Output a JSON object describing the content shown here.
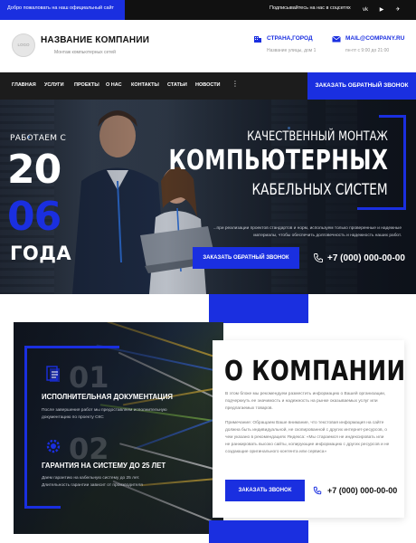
{
  "topbar": {
    "welcome": "Добро пожаловать на наш официальный сайт",
    "subscribe": "Подписывайтесь на нас в соцсетях",
    "social_icons": [
      "vk-icon",
      "youtube-icon",
      "telegram-icon"
    ],
    "social_glyphs": [
      "vk",
      "▶",
      "✈"
    ]
  },
  "header": {
    "logo_text": "LOGO",
    "company_name": "НАЗВАНИЕ КОМПАНИИ",
    "company_sub": "Монтаж компьютерных сетей",
    "location_title": "СТРАНА,ГОРОД",
    "location_sub": "Название улицы, дом 1",
    "email_title": "MAIL@COMPANY.RU",
    "email_sub": "пн-пт с 9:00 до 21:00"
  },
  "nav": {
    "items": [
      "ГЛАВНАЯ",
      "УСЛУГИ",
      "ПРОЕКТЫ",
      "О НАС",
      "КОНТАКТЫ",
      "СТАТЬИ",
      "НОВОСТИ"
    ],
    "more": "⋮",
    "cta": "ЗАКАЗАТЬ ОБРАТНЫЙ ЗВОНОК"
  },
  "hero": {
    "since_label": "РАБОТАЕМ С",
    "year_part1": "20",
    "year_part2": "06",
    "years_label": "ГОДА",
    "title_line1": "КАЧЕСТВЕННЫЙ МОНТАЖ",
    "title_line2": "КОМПЬЮТЕРНЫХ",
    "title_line3": "КАБЕЛЬНЫХ СИСТЕМ",
    "description": "...при реализации проектов стандартов и норм, используем только проверенные и надежные материалы, чтобы обеспечить долговечность и надежность наших работ.",
    "cta": "ЗАКАЗАТЬ ОБРАТНЫЙ ЗВОНОК",
    "phone": "+7 (000) 000-00-00"
  },
  "about": {
    "title": "О КОМПАНИИ",
    "p1": "В этом блоке мы рекомендуем разместить информацию о Вашей организации, подчеркнуть ее значимость и надежность на рынке оказываемых услуг или предлагаемых товаров.",
    "p2": "Примечание: Обращаем Ваше внимание, что текстовая информация на сайте должна быть индивидуальной, не скопированной с других интернет-ресурсов, о чем указано в рекомендациях Яндекса: «Мы стараемся не индексировать или не ранжировать высоко сайты, копирующие информацию с других ресурсов и не создающие оригинального контента или сервиса»",
    "cta": "ЗАКАЗАТЬ ЗВОНОК",
    "phone": "+7 (000) 000-00-00",
    "features": [
      {
        "number": "01",
        "title": "ИСПОЛНИТЕЛЬНАЯ ДОКУМЕНТАЦИЯ",
        "desc": "После завершения работ мы предоставляем исполнительную документацию по проекту СКС"
      },
      {
        "number": "02",
        "title": "ГАРАНТИЯ НА СИСТЕМУ ДО 25 ЛЕТ",
        "desc": "Даем гарантию на кабельную систему до 25 лет. Длительность гарантии зависит от производителя"
      }
    ]
  },
  "colors": {
    "accent": "#1a2fe0",
    "dark": "#111111",
    "nav": "#1c1c1c"
  }
}
